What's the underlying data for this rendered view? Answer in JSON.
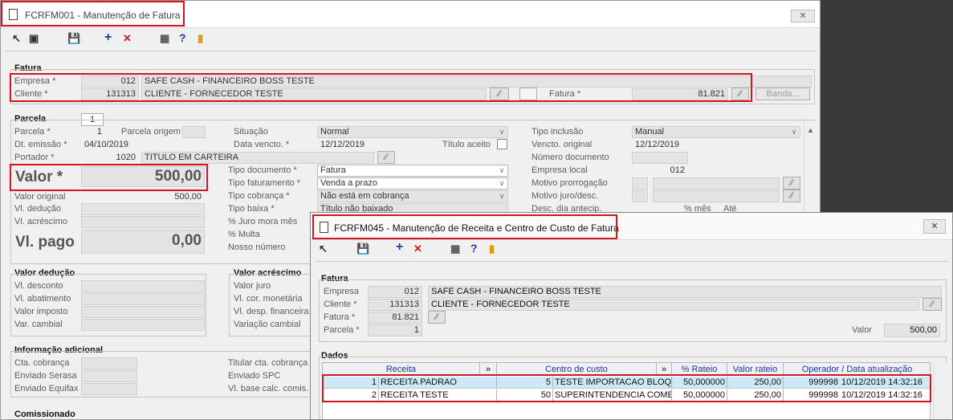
{
  "main": {
    "title": "FCRFM001 - Manutenção de Fatura",
    "fatura": {
      "section": "Fatura",
      "empresa_label": "Empresa *",
      "empresa_code": "012",
      "empresa_name": "SAFE CASH - FINANCEIRO BOSS TESTE",
      "cliente_label": "Cliente *",
      "cliente_code": "131313",
      "cliente_name": "CLIENTE - FORNECEDOR TESTE",
      "fatura_label": "Fatura *",
      "fatura_value": "81.821",
      "banda_label": "Banda..."
    },
    "parcela": {
      "section": "Parcela",
      "tab": "1",
      "parcela_label": "Parcela *",
      "parcela_value": "1",
      "origem_label": "Parcela origem",
      "emissao_label": "Dt. emissão *",
      "emissao_value": "04/10/2019",
      "portador_label": "Portador *",
      "portador_code": "1020",
      "portador_name": "TITULO EM CARTEIRA",
      "valor_label": "Valor *",
      "valor_value": "500,00",
      "valor_original_label": "Valor original",
      "valor_original_value": "500,00",
      "deducao_label": "Vl. dedução",
      "acrescimo_label": "Vl. acréscimo",
      "pago_label": "Vl. pago",
      "pago_value": "0,00",
      "situacao_label": "Situação",
      "situacao_value": "Normal",
      "vencto_label": "Data vencto. *",
      "vencto_value": "12/12/2019",
      "titulo_aceito_label": "Título aceito",
      "tipo_doc_label": "Tipo documento *",
      "tipo_doc_value": "Fatura",
      "tipo_fat_label": "Tipo faturamento *",
      "tipo_fat_value": "Venda a prazo",
      "tipo_cob_label": "Tipo cobrança *",
      "tipo_cob_value": "Não está em cobrança",
      "tipo_baixa_label": "Tipo baixa *",
      "tipo_baixa_value": "Título não baixado",
      "juro_label": "% Juro mora mês",
      "multa_label": "% Multa",
      "nosso_label": "Nosso número",
      "tipo_inclusao_label": "Tipo inclusão",
      "tipo_inclusao_value": "Manual",
      "vencto_orig_label": "Vencto. original",
      "vencto_orig_value": "12/12/2019",
      "num_doc_label": "Número documento",
      "emp_local_label": "Empresa local",
      "emp_local_value": "012",
      "motivo_prorrog_label": "Motivo prorrogação",
      "motivo_juro_label": "Motivo juro/desc.",
      "desc_dia_label": "Desc. dia antecip.",
      "pct_mes": "% mês",
      "ate": "Até"
    },
    "valor_deducao": {
      "section": "Valor dedução",
      "desconto": "Vl. desconto",
      "abatimento": "Vl. abatimento",
      "imposto": "Valor imposto",
      "cambial": "Var. cambial"
    },
    "valor_acrescimo": {
      "section": "Valor acréscimo",
      "juro": "Valor juro",
      "cor": "Vl. cor. monetária",
      "desp": "Vl. desp. financeira",
      "var": "Variação cambial"
    },
    "info": {
      "section": "Informação adicional",
      "cta": "Cta. cobrança",
      "serasa": "Enviado Serasa",
      "equifax": "Enviado Equifax",
      "titular": "Titular cta. cobrança",
      "spc": "Enviado SPC",
      "base": "Vl. base calc. comis."
    },
    "comissionado": "Comissionado"
  },
  "dialog": {
    "title": "FCRFM045 - Manutenção de Receita e Centro de Custo de Fatura",
    "fatura_section": "Fatura",
    "empresa_label": "Empresa",
    "empresa_code": "012",
    "empresa_name": "SAFE CASH - FINANCEIRO BOSS TESTE",
    "cliente_label": "Cliente *",
    "cliente_code": "131313",
    "cliente_name": "CLIENTE - FORNECEDOR TESTE",
    "fatura_label": "Fatura *",
    "fatura_value": "81.821",
    "parcela_label": "Parcela *",
    "parcela_value": "1",
    "valor_label": "Valor",
    "valor_value": "500,00",
    "dados_section": "Dados",
    "columns": [
      "Receita",
      "»",
      "Centro de custo",
      "»",
      "% Rateio",
      "Valor rateio",
      "Operador / Data atualização"
    ],
    "rows": [
      {
        "rc": "1",
        "rn": "RECEITA PADRAO",
        "cc": "5",
        "cn": "TESTE IMPORTACAO BLOQ",
        "pct": "50,000000",
        "val": "250,00",
        "op": "999998",
        "dt": "10/12/2019 14:32:16"
      },
      {
        "rc": "2",
        "rn": "RECEITA TESTE",
        "cc": "50",
        "cn": "SUPERINTENDENCIA COMERC",
        "pct": "50,000000",
        "val": "250,00",
        "op": "999998",
        "dt": "10/12/2019 14:32:16"
      }
    ]
  },
  "colors": {
    "highlight": "#d0161e",
    "header_text": "#1a3c8c",
    "selected_row": "#cde8f7"
  }
}
